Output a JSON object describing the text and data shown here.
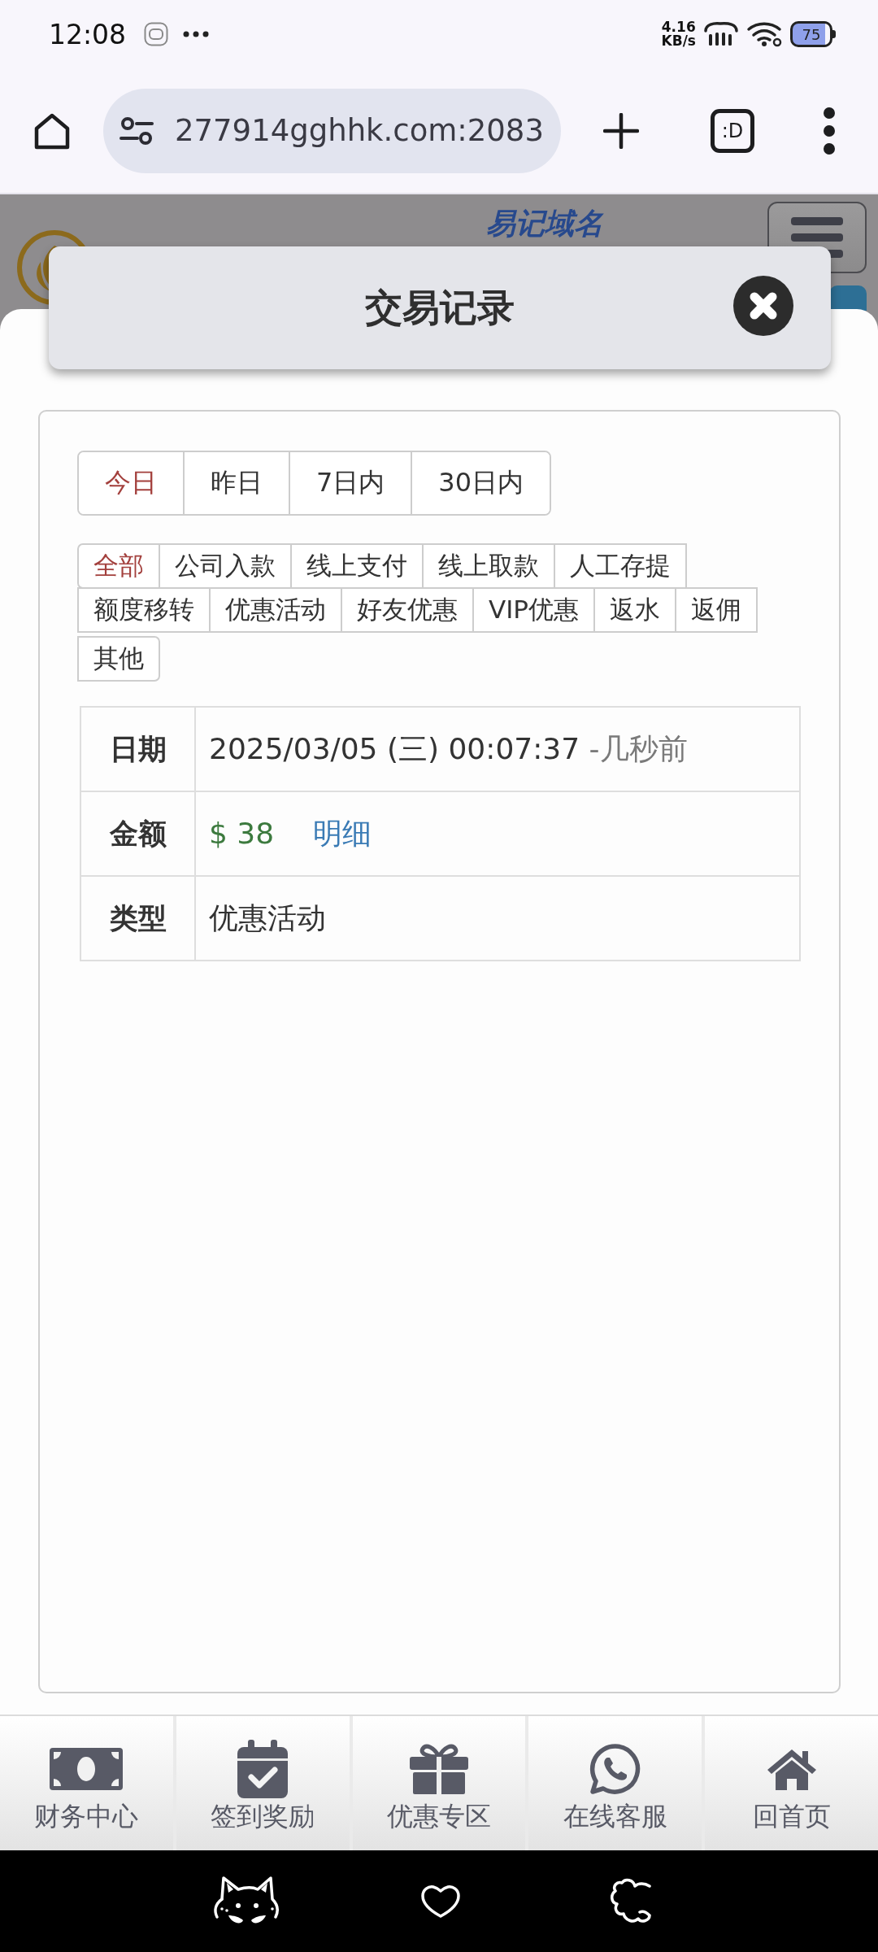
{
  "status_bar": {
    "time": "12:08",
    "net_speed": "4.16",
    "net_speed_unit": "KB/s",
    "battery": "75"
  },
  "browser": {
    "url": "277914gghhk.com:2083",
    "tab_button": ":D"
  },
  "site_header": {
    "tagline": "易记域名"
  },
  "dialog": {
    "title": "交易记录"
  },
  "date_tabs": [
    {
      "label": "今日",
      "selected": true
    },
    {
      "label": "昨日",
      "selected": false
    },
    {
      "label": "7日内",
      "selected": false
    },
    {
      "label": "30日内",
      "selected": false
    }
  ],
  "categories": [
    {
      "label": "全部",
      "selected": true
    },
    {
      "label": "公司入款",
      "selected": false
    },
    {
      "label": "线上支付",
      "selected": false
    },
    {
      "label": "线上取款",
      "selected": false
    },
    {
      "label": "人工存提",
      "selected": false
    },
    {
      "label": "额度移转",
      "selected": false
    },
    {
      "label": "优惠活动",
      "selected": false
    },
    {
      "label": "好友优惠",
      "selected": false
    },
    {
      "label": "VIP优惠",
      "selected": false
    },
    {
      "label": "返水",
      "selected": false
    },
    {
      "label": "返佣",
      "selected": false
    },
    {
      "label": "其他",
      "selected": false
    }
  ],
  "record": {
    "rows": [
      {
        "kind": "date",
        "label": "日期",
        "value": "2025/03/05 (三) 00:07:37",
        "relative": "-几秒前"
      },
      {
        "kind": "amount",
        "label": "金额",
        "value": "$ 38",
        "link": "明细"
      },
      {
        "kind": "text",
        "label": "类型",
        "value": "优惠活动"
      }
    ]
  },
  "bottom_nav": [
    {
      "label": "财务中心"
    },
    {
      "label": "签到奖励"
    },
    {
      "label": "优惠专区"
    },
    {
      "label": "在线客服"
    },
    {
      "label": "回首页"
    }
  ]
}
